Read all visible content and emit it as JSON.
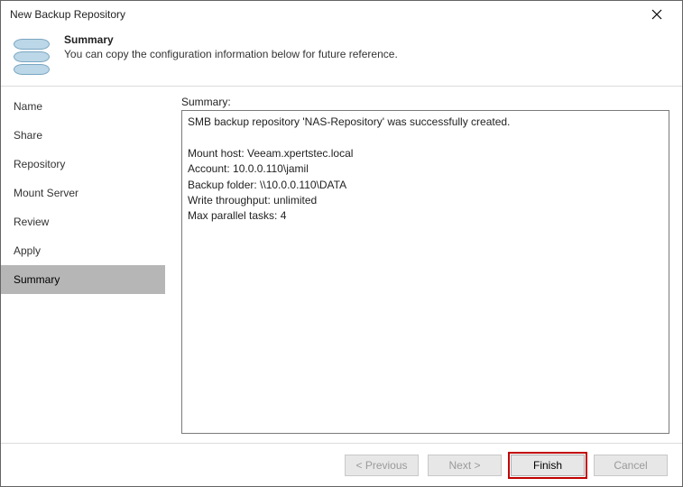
{
  "window": {
    "title": "New Backup Repository"
  },
  "header": {
    "title": "Summary",
    "subtitle": "You can copy the configuration information below for future reference."
  },
  "nav": {
    "items": [
      {
        "label": "Name"
      },
      {
        "label": "Share"
      },
      {
        "label": "Repository"
      },
      {
        "label": "Mount Server"
      },
      {
        "label": "Review"
      },
      {
        "label": "Apply"
      },
      {
        "label": "Summary"
      }
    ],
    "active_index": 6
  },
  "content": {
    "summary_label": "Summary:",
    "summary_text": "SMB backup repository 'NAS-Repository' was successfully created.\n\nMount host: Veeam.xpertstec.local\nAccount: 10.0.0.110\\jamil\nBackup folder: \\\\10.0.0.110\\DATA\nWrite throughput: unlimited\nMax parallel tasks: 4"
  },
  "footer": {
    "previous": "< Previous",
    "next": "Next >",
    "finish": "Finish",
    "cancel": "Cancel"
  }
}
